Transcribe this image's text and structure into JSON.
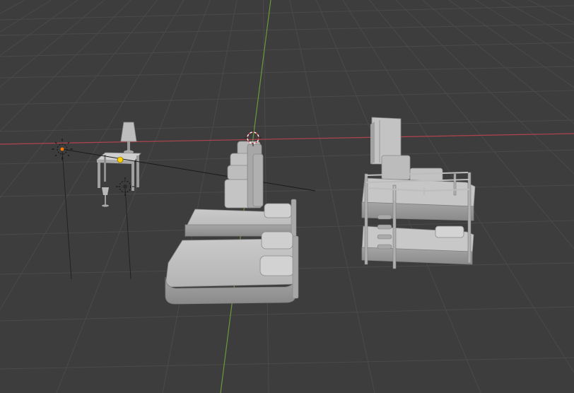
{
  "viewport": {
    "type": "3d-viewport",
    "background": "#3d3d3d",
    "grid_color": "#4a4a4a",
    "x_axis_color": "#b0434d",
    "y_axis_color": "#6a9a3a",
    "mesh_color": "#c8c8c8",
    "selected_origin_color": "#ffd000",
    "light_origin_color": "#ff7a00",
    "cursor_color": "#e04848"
  },
  "objects": [
    {
      "name": "nightstand",
      "kind": "mesh"
    },
    {
      "name": "table-lamp",
      "kind": "mesh"
    },
    {
      "name": "wine-glass",
      "kind": "mesh"
    },
    {
      "name": "point-light-left",
      "kind": "light"
    },
    {
      "name": "point-light-middle",
      "kind": "light"
    },
    {
      "name": "single-bed-back",
      "kind": "mesh"
    },
    {
      "name": "double-bed-front",
      "kind": "mesh"
    },
    {
      "name": "wardrobe",
      "kind": "mesh"
    },
    {
      "name": "bunk-bed",
      "kind": "mesh"
    },
    {
      "name": "3d-cursor",
      "kind": "cursor"
    }
  ]
}
